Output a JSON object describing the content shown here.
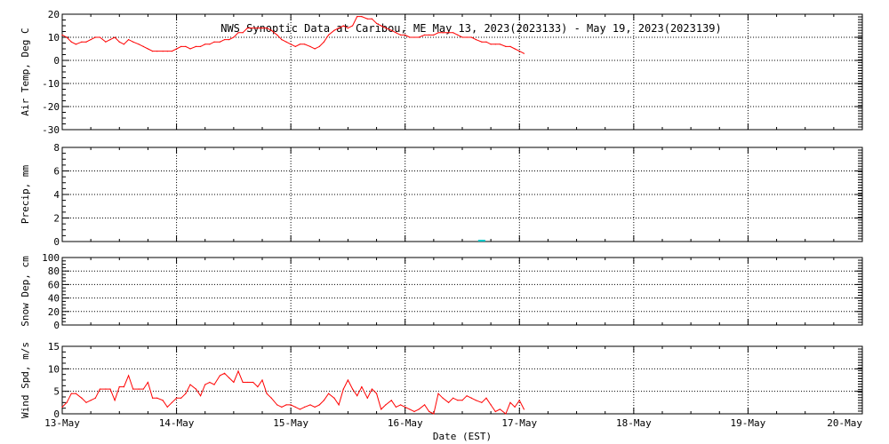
{
  "title": "NWS Synoptic Data at Caribou, ME   May 13, 2023(2023133) - May 19, 2023(2023139)",
  "xlabel": "Date (EST)",
  "x_tick_labels": [
    "13-May",
    "14-May",
    "15-May",
    "16-May",
    "17-May",
    "18-May",
    "19-May",
    "20-May"
  ],
  "colors": {
    "line": "#ff0000",
    "precip": "#00c8c8",
    "axis": "#000000",
    "grid": "#000000"
  },
  "chart_data": [
    {
      "type": "line",
      "ylabel": "Air Temp, Deg C",
      "ylim": [
        -30,
        20
      ],
      "yticks": [
        -30,
        -20,
        -10,
        0,
        10,
        20
      ],
      "xlim": [
        0,
        7
      ],
      "x_unit": "days since 13-May 00:00 EST",
      "grid": true,
      "x": [
        0.0,
        0.04,
        0.08,
        0.12,
        0.17,
        0.21,
        0.25,
        0.29,
        0.33,
        0.38,
        0.42,
        0.46,
        0.5,
        0.54,
        0.58,
        0.62,
        0.67,
        0.71,
        0.75,
        0.79,
        0.83,
        0.88,
        0.92,
        0.96,
        1.0,
        1.04,
        1.08,
        1.12,
        1.17,
        1.21,
        1.25,
        1.29,
        1.33,
        1.38,
        1.42,
        1.46,
        1.5,
        1.54,
        1.58,
        1.62,
        1.67,
        1.71,
        1.75,
        1.79,
        1.83,
        1.88,
        1.92,
        1.96,
        2.0,
        2.04,
        2.08,
        2.12,
        2.17,
        2.21,
        2.25,
        2.29,
        2.33,
        2.38,
        2.42,
        2.46,
        2.5,
        2.54,
        2.58,
        2.62,
        2.67,
        2.71,
        2.75,
        2.79,
        2.83,
        2.88,
        2.92,
        2.96,
        3.0,
        3.04,
        3.08,
        3.12,
        3.17,
        3.21,
        3.25,
        3.29,
        3.33,
        3.38,
        3.42,
        3.46,
        3.5,
        3.54,
        3.58,
        3.62,
        3.67,
        3.71,
        3.75,
        3.79,
        3.83,
        3.88,
        3.92,
        3.96,
        4.0,
        4.04
      ],
      "values": [
        11,
        10,
        8,
        7,
        8,
        8,
        9,
        10,
        10,
        8,
        9,
        10,
        8,
        7,
        9,
        8,
        7,
        6,
        5,
        4,
        4,
        4,
        4,
        4,
        5,
        6,
        6,
        5,
        6,
        6,
        7,
        7,
        8,
        8,
        9,
        9,
        10,
        12,
        12,
        14,
        14,
        14,
        14,
        14,
        13,
        11,
        9,
        8,
        7,
        6,
        7,
        7,
        6,
        5,
        6,
        8,
        11,
        13,
        14,
        15,
        14,
        15,
        19,
        19,
        18,
        18,
        16,
        15,
        14,
        13,
        12,
        11,
        11,
        10,
        10,
        10,
        11,
        11,
        11,
        12,
        12,
        12,
        12,
        11,
        10,
        10,
        10,
        9,
        8,
        8,
        7,
        7,
        7,
        6,
        6,
        5,
        4,
        3
      ]
    },
    {
      "type": "bar",
      "ylabel": "Precip, mm",
      "ylim": [
        0,
        8
      ],
      "yticks": [
        0,
        2,
        4,
        6,
        8
      ],
      "xlim": [
        0,
        7
      ],
      "grid": true,
      "x": [
        3.67
      ],
      "values": [
        0.08
      ]
    },
    {
      "type": "line",
      "ylabel": "Snow Dep, cm",
      "ylim": [
        0,
        100
      ],
      "yticks": [
        0,
        20,
        40,
        60,
        80,
        100
      ],
      "xlim": [
        0,
        7
      ],
      "grid": true,
      "x": [],
      "values": []
    },
    {
      "type": "line",
      "ylabel": "Wind Spd, m/s",
      "ylim": [
        0,
        15
      ],
      "yticks": [
        0,
        5,
        10,
        15
      ],
      "xlim": [
        0,
        7
      ],
      "grid": true,
      "x": [
        0.0,
        0.04,
        0.08,
        0.12,
        0.17,
        0.21,
        0.25,
        0.29,
        0.33,
        0.38,
        0.42,
        0.46,
        0.5,
        0.54,
        0.58,
        0.62,
        0.67,
        0.71,
        0.75,
        0.79,
        0.83,
        0.88,
        0.92,
        0.96,
        1.0,
        1.04,
        1.08,
        1.12,
        1.17,
        1.21,
        1.25,
        1.29,
        1.33,
        1.38,
        1.42,
        1.46,
        1.5,
        1.54,
        1.58,
        1.62,
        1.67,
        1.71,
        1.75,
        1.79,
        1.83,
        1.88,
        1.92,
        1.96,
        2.0,
        2.04,
        2.08,
        2.12,
        2.17,
        2.21,
        2.25,
        2.29,
        2.33,
        2.38,
        2.42,
        2.46,
        2.5,
        2.54,
        2.58,
        2.62,
        2.67,
        2.71,
        2.75,
        2.79,
        2.83,
        2.88,
        2.92,
        2.96,
        3.0,
        3.04,
        3.08,
        3.12,
        3.17,
        3.21,
        3.25,
        3.29,
        3.33,
        3.38,
        3.42,
        3.46,
        3.5,
        3.54,
        3.58,
        3.62,
        3.67,
        3.71,
        3.75,
        3.79,
        3.83,
        3.88,
        3.92,
        3.96,
        4.0,
        4.04
      ],
      "values": [
        1.5,
        2.5,
        4.5,
        4.5,
        3.5,
        2.5,
        3,
        3.5,
        5.5,
        5.5,
        5.5,
        3,
        6,
        6,
        8.5,
        5.5,
        5.5,
        5.5,
        7,
        3.5,
        3.5,
        3,
        1.5,
        2.5,
        3.5,
        3.5,
        4.5,
        6.5,
        5.5,
        4,
        6.5,
        7,
        6.5,
        8.5,
        9,
        8,
        7,
        9.5,
        7,
        7,
        7,
        6,
        7.5,
        4.5,
        3.5,
        2,
        1.5,
        2,
        2,
        1.5,
        1,
        1.5,
        2,
        1.5,
        2,
        3,
        4.5,
        3.5,
        2,
        5.5,
        7.5,
        5.5,
        4,
        6,
        3.5,
        5.5,
        4.5,
        1,
        2,
        3,
        1.5,
        2,
        1.5,
        1,
        0.5,
        1,
        2,
        0.5,
        0,
        4.5,
        3.5,
        2.5,
        3.5,
        3,
        3,
        4,
        3.5,
        3,
        2.5,
        3.5,
        2,
        0.5,
        1,
        0,
        2.5,
        1.5,
        3,
        1
      ]
    }
  ]
}
